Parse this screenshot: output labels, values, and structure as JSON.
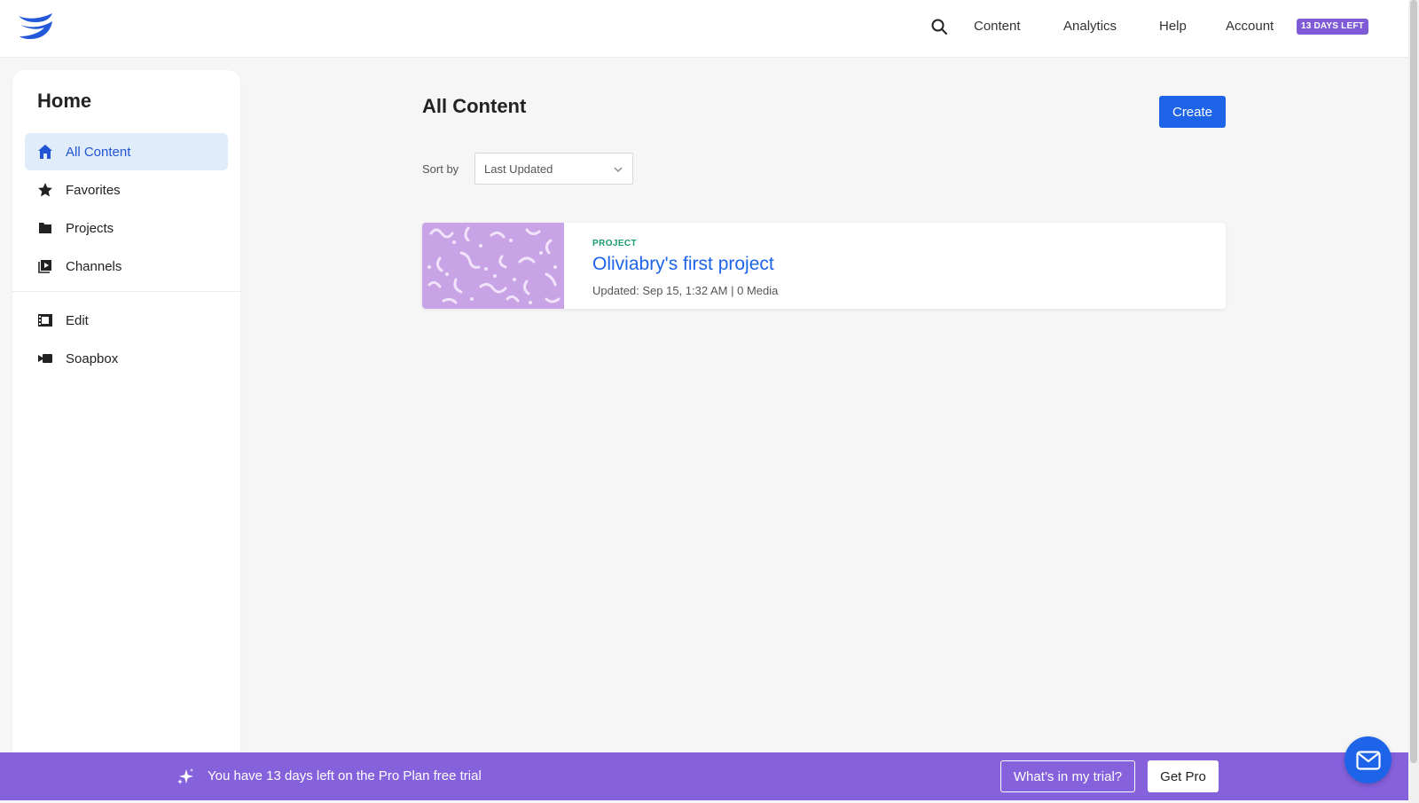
{
  "topnav": {
    "logo_icon": "wistia-logo-icon",
    "search_icon": "search-icon",
    "links": [
      "Content",
      "Analytics",
      "Help",
      "Account"
    ],
    "trial_badge": "13 DAYS LEFT"
  },
  "sidebar": {
    "title": "Home",
    "items": [
      {
        "label": "All Content",
        "icon": "home-icon",
        "active": true
      },
      {
        "label": "Favorites",
        "icon": "star-icon",
        "active": false
      },
      {
        "label": "Projects",
        "icon": "folder-icon",
        "active": false
      },
      {
        "label": "Channels",
        "icon": "channels-icon",
        "active": false
      },
      {
        "label": "Edit",
        "icon": "film-icon",
        "active": false
      },
      {
        "label": "Soapbox",
        "icon": "camera-icon",
        "active": false
      }
    ]
  },
  "main": {
    "title": "All Content",
    "create_label": "Create",
    "sort_label": "Sort by",
    "sort_value": "Last Updated",
    "cards": [
      {
        "kind": "PROJECT",
        "title": "Oliviabry's first project",
        "meta": "Updated: Sep 15, 1:32 AM | 0 Media"
      }
    ]
  },
  "banner": {
    "icon": "sparkle-icon",
    "text": "You have 13 days left on the Pro Plan free trial",
    "trial_label": "What’s in my trial?",
    "pro_label": "Get Pro"
  },
  "chat": {
    "icon": "mail-icon"
  },
  "colors": {
    "accent": "#1e64e8",
    "banner": "#8561dc",
    "badge": "#7f5bd7",
    "active_bg": "#e1ecfb",
    "thumbnail": "#c8a3e6",
    "kind_label": "#1a9b6a"
  }
}
